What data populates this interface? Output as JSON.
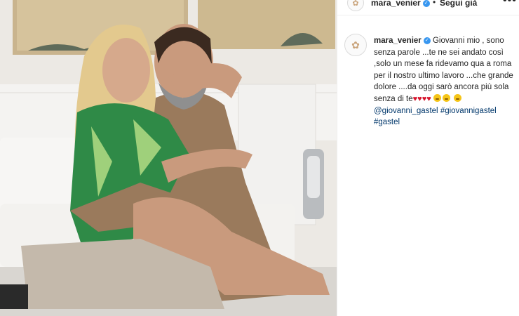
{
  "post": {
    "username": "mara_venier",
    "verified": true,
    "follow_status": "Segui già",
    "header_separator": "•",
    "more_icon": "more-horizontal-icon",
    "comment": {
      "username": "mara_venier",
      "text": "Giovanni mio , sono senza parole ...te ne sei andato così ,solo un mese fa ridevamo qua a roma per il nostro ultimo lavoro ...che grande dolore ....da oggi sarò ancora più sola senza di te",
      "hearts": [
        "♥",
        "♥",
        "♥",
        "♥"
      ],
      "mentions": [
        "@giovanni_gastel"
      ],
      "hashtags": [
        "#giovannigastel",
        "#gastel"
      ]
    }
  },
  "colors": {
    "link": "#00376b",
    "verified": "#3897f0",
    "heart": "#d6132b",
    "text": "#262626"
  }
}
